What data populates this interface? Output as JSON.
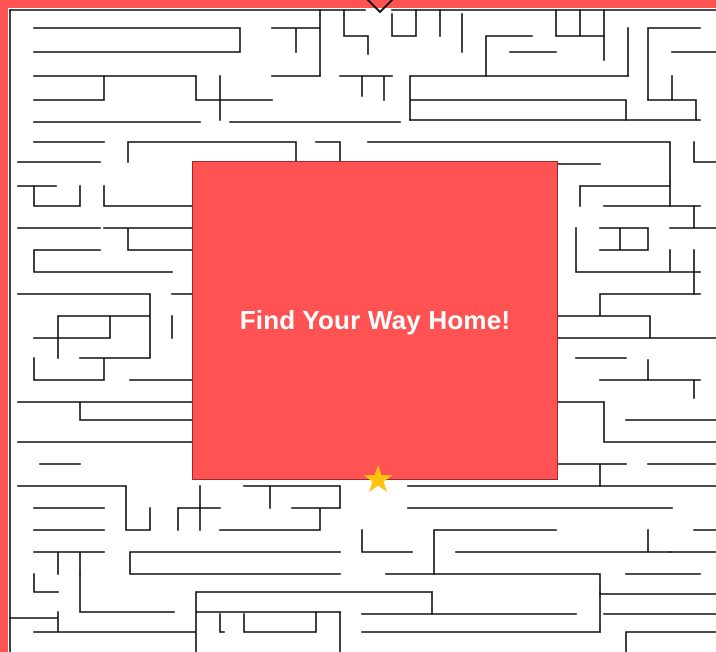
{
  "puzzle": {
    "title": "Find Your Way Home!",
    "goal_icon": "star-icon",
    "entrance_icon": "entrance-arrow-icon"
  },
  "colors": {
    "border": "#ff5252",
    "panel": "#ff5252",
    "maze_lines": "#111111",
    "star": "#ffc20e",
    "title_text": "#ffffff"
  }
}
